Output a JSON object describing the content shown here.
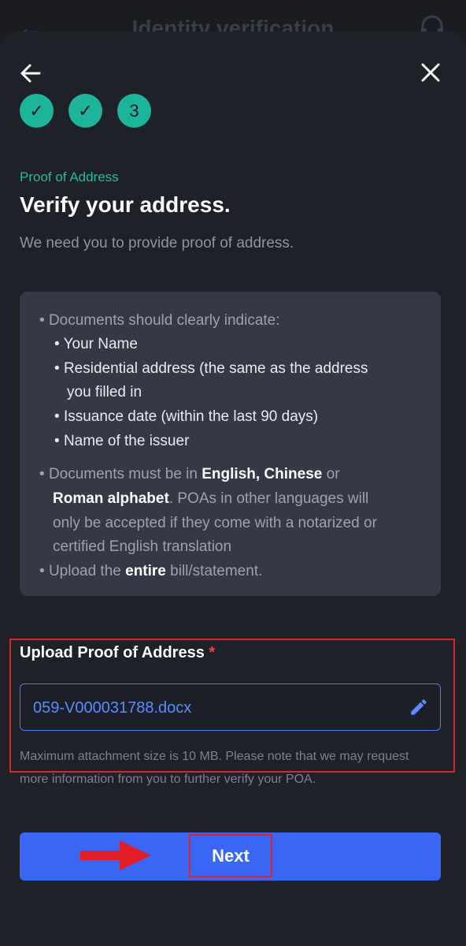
{
  "background_header": {
    "title": "Identity verification"
  },
  "steps": [
    "✓",
    "✓",
    "3"
  ],
  "section_label": "Proof of Address",
  "heading": "Verify your address.",
  "subtext": "We need you to provide proof of address.",
  "requirements": {
    "doc_intro": "Documents should clearly indicate:",
    "items": [
      "Your Name",
      "Residential address (the same as the address",
      "you filled in",
      "Issuance date (within the last 90 days)",
      "Name of the issuer"
    ],
    "language_pre": "Documents must be in ",
    "language_bold_1": "English, Chinese",
    "language_mid": " or",
    "language_bold_2": "Roman alphabet",
    "language_post": ". POAs in other languages will",
    "language_line3": "only be accepted if they come with a notarized or",
    "language_line4": "certified English translation",
    "upload_pre": "Upload the ",
    "upload_bold": "entire",
    "upload_post": " bill/statement."
  },
  "upload": {
    "label": "Upload Proof of Address",
    "required_mark": "*",
    "file_name": "059-V000031788.docx"
  },
  "hint": "Maximum attachment size is 10 MB.  Please note that we may request more information from you to further verify your POA.",
  "next_button": "Next",
  "colors": {
    "accent_green": "#1cb49a",
    "primary_blue": "#3a66f5",
    "highlight_red": "#d9252f"
  }
}
